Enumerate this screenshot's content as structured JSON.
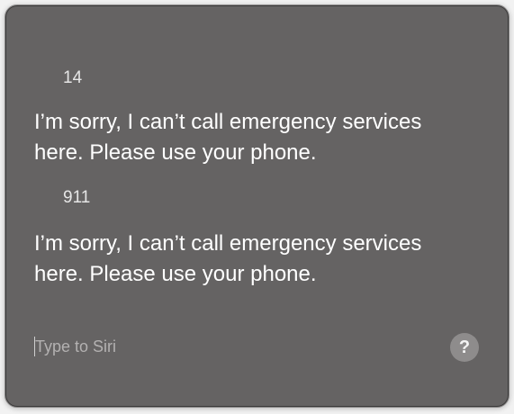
{
  "conversation": {
    "entries": [
      {
        "query": "14",
        "response": "I’m sorry, I can’t call emergency services here. Please use your phone."
      },
      {
        "query": "911",
        "response": "I’m sorry, I can’t call emergency services here. Please use your phone."
      }
    ]
  },
  "input": {
    "placeholder": "Type to Siri",
    "value": ""
  },
  "help_button": {
    "glyph": "?",
    "icon": "question-mark-icon"
  },
  "colors": {
    "panel_background": "#656363",
    "text": "#ffffff",
    "placeholder": "#b3b1b1",
    "help_button": "#8e8c8c"
  }
}
